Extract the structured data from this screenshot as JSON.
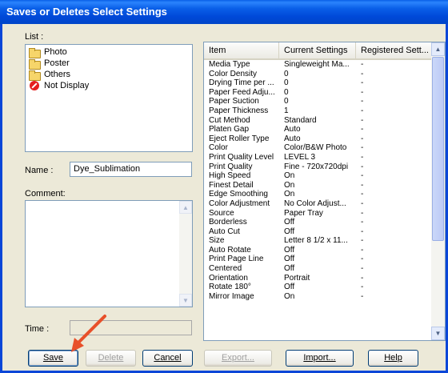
{
  "window": {
    "title": "Saves or Deletes Select Settings"
  },
  "list": {
    "label": "List :",
    "items": [
      {
        "label": "Photo",
        "icon": "folder-icon"
      },
      {
        "label": "Poster",
        "icon": "folder-icon"
      },
      {
        "label": "Others",
        "icon": "folder-icon"
      },
      {
        "label": "Not Display",
        "icon": "no-entry-icon"
      }
    ]
  },
  "name": {
    "label": "Name :",
    "value": "Dye_Sublimation"
  },
  "comment": {
    "label": "Comment:",
    "value": ""
  },
  "time": {
    "label": "Time :",
    "value": ""
  },
  "grid": {
    "columns": [
      "Item",
      "Current Settings",
      "Registered Sett..."
    ],
    "rows": [
      [
        "Media Type",
        "Singleweight Ma...",
        "-"
      ],
      [
        "Color Density",
        "0",
        "-"
      ],
      [
        "Drying Time per ...",
        "0",
        "-"
      ],
      [
        "Paper Feed Adju...",
        "0",
        "-"
      ],
      [
        "Paper Suction",
        "0",
        "-"
      ],
      [
        "Paper Thickness",
        "1",
        "-"
      ],
      [
        "Cut Method",
        "Standard",
        "-"
      ],
      [
        "Platen Gap",
        "Auto",
        "-"
      ],
      [
        "Eject Roller Type",
        "Auto",
        "-"
      ],
      [
        "Color",
        "Color/B&W Photo",
        "-"
      ],
      [
        "Print Quality Level",
        "LEVEL 3",
        "-"
      ],
      [
        "Print Quality",
        "Fine - 720x720dpi",
        "-"
      ],
      [
        "High Speed",
        "On",
        "-"
      ],
      [
        "Finest Detail",
        "On",
        "-"
      ],
      [
        "Edge Smoothing",
        "On",
        "-"
      ],
      [
        "Color Adjustment",
        "No Color Adjust...",
        "-"
      ],
      [
        "Source",
        "Paper Tray",
        "-"
      ],
      [
        "Borderless",
        "Off",
        "-"
      ],
      [
        "Auto Cut",
        "Off",
        "-"
      ],
      [
        "Size",
        "Letter 8 1/2 x 11...",
        "-"
      ],
      [
        "Auto Rotate",
        "Off",
        "-"
      ],
      [
        "Print Page Line",
        "Off",
        "-"
      ],
      [
        "Centered",
        "Off",
        "-"
      ],
      [
        "Orientation",
        "Portrait",
        "-"
      ],
      [
        "Rotate 180°",
        "Off",
        "-"
      ],
      [
        "Mirror Image",
        "On",
        "-"
      ]
    ]
  },
  "buttons": {
    "save": "Save",
    "delete": "Delete",
    "cancel": "Cancel",
    "export": "Export...",
    "import": "Import...",
    "help": "Help"
  },
  "colors": {
    "title_bar": "#0a5fe8",
    "annotation_arrow": "#e8502a"
  }
}
